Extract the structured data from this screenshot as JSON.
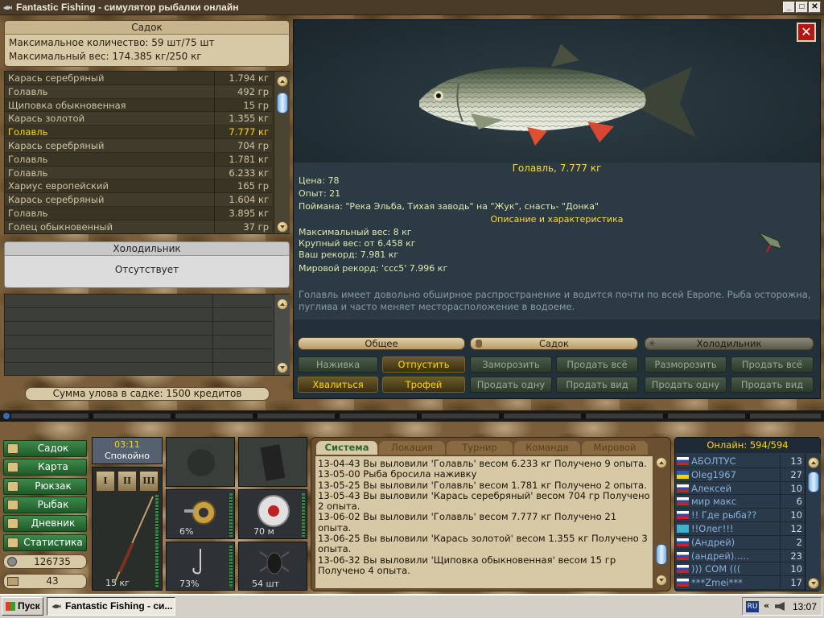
{
  "window": {
    "title": "Fantastic Fishing - симулятор рыбалки онлайн",
    "btn_min": "_",
    "btn_max": "□",
    "btn_close": "✕"
  },
  "sadok": {
    "title": "Садок",
    "max_count": "Максимальное количество: 59 шт/75 шт",
    "max_weight": "Максимальный вес: 174.385 кг/250 кг",
    "items": [
      {
        "name": "Карась серебряный",
        "weight": "1.794 кг"
      },
      {
        "name": "Голавль",
        "weight": "492 гр"
      },
      {
        "name": "Щиповка обыкновенная",
        "weight": "15 гр"
      },
      {
        "name": "Карась золотой",
        "weight": "1.355 кг"
      },
      {
        "name": "Голавль",
        "weight": "7.777 кг",
        "selected": true
      },
      {
        "name": "Карась серебряный",
        "weight": "704 гр"
      },
      {
        "name": "Голавль",
        "weight": "1.781 кг"
      },
      {
        "name": "Голавль",
        "weight": "6.233 кг"
      },
      {
        "name": "Хариус европейский",
        "weight": "165 гр"
      },
      {
        "name": "Карась серебряный",
        "weight": "1.604 кг"
      },
      {
        "name": "Голавль",
        "weight": "3.895 кг"
      },
      {
        "name": "Голец обыкновенный",
        "weight": "37 гр"
      }
    ],
    "sum": "Сумма улова в садке: 1500 кредитов"
  },
  "fridge": {
    "title": "Холодильник",
    "status": "Отсутствует"
  },
  "fish": {
    "caption": "Голавль, 7.777 кг",
    "price": "Цена: 78",
    "exp": "Опыт: 21",
    "caught": "Поймана: \"Река Эльба, Тихая заводь\" на \"Жук\", снасть- \"Донка\"",
    "desc_header": "Описание и характеристика",
    "max_weight": "Максимальный вес: 8 кг",
    "big_weight": "Крупный вес: от 6.458 кг",
    "your_record": "Ваш рекорд: 7.981 кг",
    "world_record": "Мировой рекорд: 'ccc5' 7.996 кг",
    "description": "Голавль имеет довольно обширное распространение и водится почти по всей Европе. Рыба осторожна, пуглива и часто меняет месторасположение в водоеме."
  },
  "actions": {
    "general": {
      "title": "Общее",
      "bait": "Наживка",
      "release": "Отпустить",
      "brag": "Хвалиться",
      "trophy": "Трофей"
    },
    "sadok": {
      "title": "Садок",
      "freeze": "Заморозить",
      "sell_all": "Продать всё",
      "sell_one": "Продать одну",
      "sell_kind": "Продать вид"
    },
    "fridge": {
      "title": "Холодильник",
      "unfreeze": "Разморозить",
      "sell_all": "Продать всё",
      "sell_one": "Продать одну",
      "sell_kind": "Продать вид"
    }
  },
  "nav": [
    "Садок",
    "Карта",
    "Рюкзак",
    "Рыбак",
    "Дневник",
    "Статистика"
  ],
  "money": "126735",
  "level": "43",
  "gear": {
    "time": "03:11",
    "weather": "Спокойно",
    "rod_slots": [
      "I",
      "II",
      "III"
    ],
    "rod_weight": "15 кг",
    "reel_pct": "6%",
    "line_m": "70 м",
    "hook_pct": "73%",
    "bait_count": "54 шт"
  },
  "chat": {
    "tabs": [
      "Система",
      "Локация",
      "Турнир",
      "Команда",
      "Мировой"
    ],
    "lines": [
      "13-04-43 Вы выловили 'Голавль' весом 6.233 кг Получено 9 опыта.",
      "13-05-00 Рыба бросила наживку",
      "13-05-25 Вы выловили 'Голавль' весом 1.781 кг Получено 2 опыта.",
      "13-05-43 Вы выловили 'Карась серебряный' весом 704 гр Получено 2 опыта.",
      "13-06-02 Вы выловили 'Голавль' весом 7.777 кг Получено 21 опыта.",
      "13-06-25 Вы выловили 'Карась золотой' весом 1.355 кг Получено 3 опыта.",
      "13-06-32 Вы выловили 'Щиповка обыкновенная' весом 15 гр Получено 4 опыта."
    ]
  },
  "online": {
    "title": "Онлайн: 594/594",
    "users": [
      {
        "name": "АБОЛТУС",
        "lvl": "13"
      },
      {
        "name": "Oleg1967",
        "lvl": "27"
      },
      {
        "name": "Алексей",
        "lvl": "10"
      },
      {
        "name": "мир макс",
        "lvl": "6"
      },
      {
        "name": "!! Где рыба??",
        "lvl": "10"
      },
      {
        "name": "!!Олег!!!",
        "lvl": "12"
      },
      {
        "name": "(Андрей)",
        "lvl": "2"
      },
      {
        "name": "(андрей).....",
        "lvl": "23"
      },
      {
        "name": "))) СОМ (((",
        "lvl": "10"
      },
      {
        "name": "***Zmei***",
        "lvl": "17"
      }
    ]
  },
  "taskbar": {
    "start": "Пуск",
    "task": "Fantastic Fishing - си...",
    "lang": "RU",
    "arrows": "«",
    "time": "13:07"
  }
}
